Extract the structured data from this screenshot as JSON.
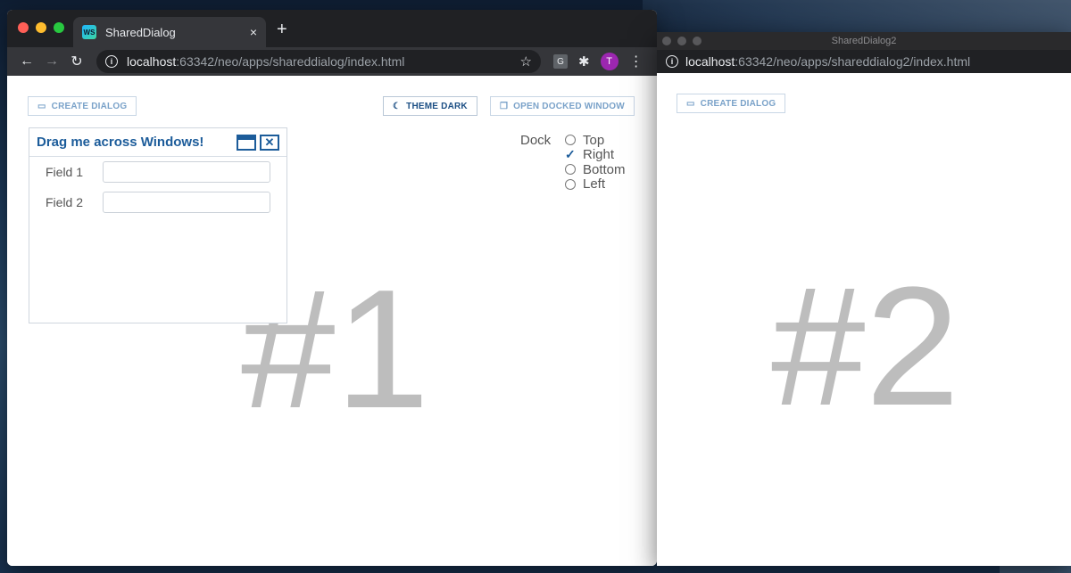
{
  "window1": {
    "tab_title": "SharedDialog",
    "tab_favicon": "WS",
    "tab_close": "×",
    "new_tab": "+",
    "url_host": "localhost",
    "url_rest": ":63342/neo/apps/shareddialog/index.html",
    "extension_g": "G",
    "avatar_letter": "T",
    "buttons": {
      "create_dialog": "CREATE DIALOG",
      "theme_dark": "THEME DARK",
      "open_docked_window": "OPEN DOCKED WINDOW"
    },
    "dialog": {
      "title": "Drag me across Windows!",
      "field1_label": "Field 1",
      "field2_label": "Field 2"
    },
    "dock": {
      "label": "Dock",
      "options": [
        {
          "label": "Top",
          "checked": false
        },
        {
          "label": "Right",
          "checked": true
        },
        {
          "label": "Bottom",
          "checked": false
        },
        {
          "label": "Left",
          "checked": false
        }
      ]
    },
    "big_number": "#1"
  },
  "window2": {
    "title": "SharedDialog2",
    "url_host": "localhost",
    "url_rest": ":63342/neo/apps/shareddialog2/index.html",
    "create_dialog": "CREATE DIALOG",
    "big_number": "#2"
  },
  "colors": {
    "accent": "#1c5c9a",
    "button_text": "#7aa2c9",
    "big_number": "#bdbdbd",
    "chrome_dark": "#202124"
  }
}
